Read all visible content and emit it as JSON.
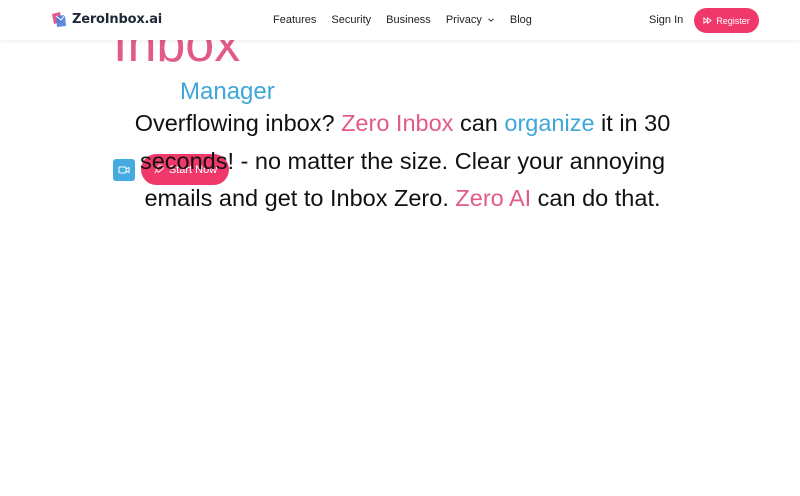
{
  "brand": {
    "name": "ZeroInbox.ai",
    "accent": "#f0386b",
    "pink": "#e15a8a",
    "blue": "#3fa6d9"
  },
  "nav": {
    "items": [
      {
        "label": "Features"
      },
      {
        "label": "Security"
      },
      {
        "label": "Business"
      },
      {
        "label": "Privacy",
        "has_dropdown": true
      },
      {
        "label": "Blog"
      }
    ],
    "signin_label": "Sign In",
    "register_label": "Register"
  },
  "hero": {
    "big_word": "Inbox",
    "subtitle": "Manager",
    "desc": {
      "p1": "Overflowing inbox? ",
      "zero_inbox": "Zero Inbox",
      "p2": " can ",
      "organize": "organize",
      "p3": " it in 30 seconds! - no matter the size. Clear your annoying emails and get to Inbox Zero. ",
      "zero_ai": "Zero AI",
      "p4": " can do that."
    },
    "start_label": "Start Now"
  },
  "icons": {
    "logo": "zeroinbox-logo-icon",
    "chevron": "chevron-down-icon",
    "register": "fast-forward-icon",
    "video": "video-camera-icon",
    "start": "rocket-icon"
  }
}
